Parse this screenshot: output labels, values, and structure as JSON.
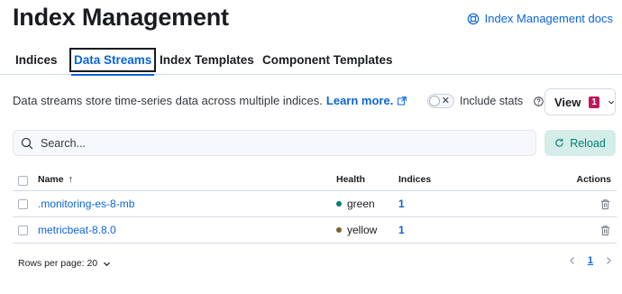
{
  "header": {
    "title": "Index Management",
    "docs_link": "Index Management docs"
  },
  "tabs": [
    {
      "label": "Indices",
      "selected": false
    },
    {
      "label": "Data Streams",
      "selected": true
    },
    {
      "label": "Index Templates",
      "selected": false
    },
    {
      "label": "Component Templates",
      "selected": false
    }
  ],
  "description": {
    "text": "Data streams store time-series data across multiple indices.",
    "learn_more": "Learn more."
  },
  "include_stats": {
    "label": "Include stats",
    "enabled": false
  },
  "view": {
    "label": "View",
    "badge": "1"
  },
  "search": {
    "placeholder": "Search..."
  },
  "reload": {
    "label": "Reload"
  },
  "table": {
    "headers": {
      "name": "Name",
      "health": "Health",
      "indices": "Indices",
      "actions": "Actions"
    },
    "rows": [
      {
        "name": ".monitoring-es-8-mb",
        "health": "green",
        "health_color": "#007e73",
        "indices": "1"
      },
      {
        "name": "metricbeat-8.8.0",
        "health": "yellow",
        "health_color": "#7a6428",
        "indices": "1"
      }
    ]
  },
  "pagination": {
    "rows_per_page": "Rows per page: 20",
    "current_page": "1"
  },
  "colors": {
    "accent": "#0b64dd",
    "reload_bg": "#d4ede9",
    "badge": "#c0185b"
  }
}
